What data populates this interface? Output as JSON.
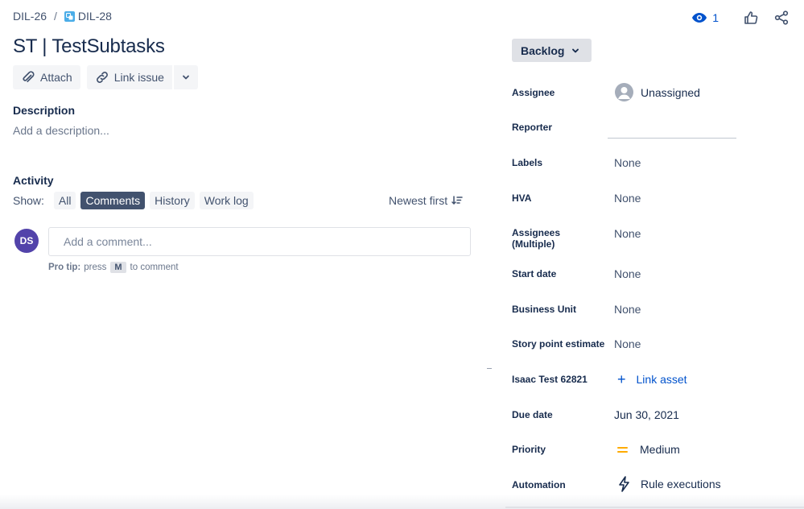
{
  "breadcrumb": {
    "parent": "DIL-26",
    "separator": "/",
    "current": "DIL-28"
  },
  "top_actions": {
    "watch_count": "1"
  },
  "issue": {
    "title": "ST | TestSubtasks"
  },
  "toolbar": {
    "attach": "Attach",
    "link_issue": "Link issue"
  },
  "description": {
    "heading": "Description",
    "placeholder": "Add a description..."
  },
  "activity": {
    "heading": "Activity",
    "show_label": "Show:",
    "filters": [
      "All",
      "Comments",
      "History",
      "Work log"
    ],
    "active_filter": "Comments",
    "sort_label": "Newest first",
    "avatar_initials": "DS",
    "comment_placeholder": "Add a comment...",
    "protip_bold": "Pro tip:",
    "protip_press": "press",
    "protip_key": "M",
    "protip_suffix": "to comment"
  },
  "status": {
    "label": "Backlog"
  },
  "fields": {
    "assignee": {
      "label": "Assignee",
      "value": "Unassigned"
    },
    "reporter": {
      "label": "Reporter",
      "value": ""
    },
    "labels": {
      "label": "Labels",
      "value": "None"
    },
    "hva": {
      "label": "HVA",
      "value": "None"
    },
    "assignees_multiple": {
      "label_line1": "Assignees",
      "label_line2": "(Multiple)",
      "value": "None"
    },
    "start_date": {
      "label": "Start date",
      "value": "None"
    },
    "business_unit": {
      "label": "Business Unit",
      "value": "None"
    },
    "story_points": {
      "label": "Story point estimate",
      "value": "None"
    },
    "isaac_test": {
      "label": "Isaac Test 62821",
      "value": "Link asset"
    },
    "due_date": {
      "label": "Due date",
      "value": "Jun 30, 2021"
    },
    "priority": {
      "label": "Priority",
      "value": "Medium"
    },
    "automation": {
      "label": "Automation",
      "value": "Rule executions"
    }
  },
  "colors": {
    "accent": "#0052CC",
    "active_filter": "#42526E",
    "avatar": "#5243AA",
    "priority_medium": "#FFAB00",
    "subtask": "#4BADE8"
  }
}
